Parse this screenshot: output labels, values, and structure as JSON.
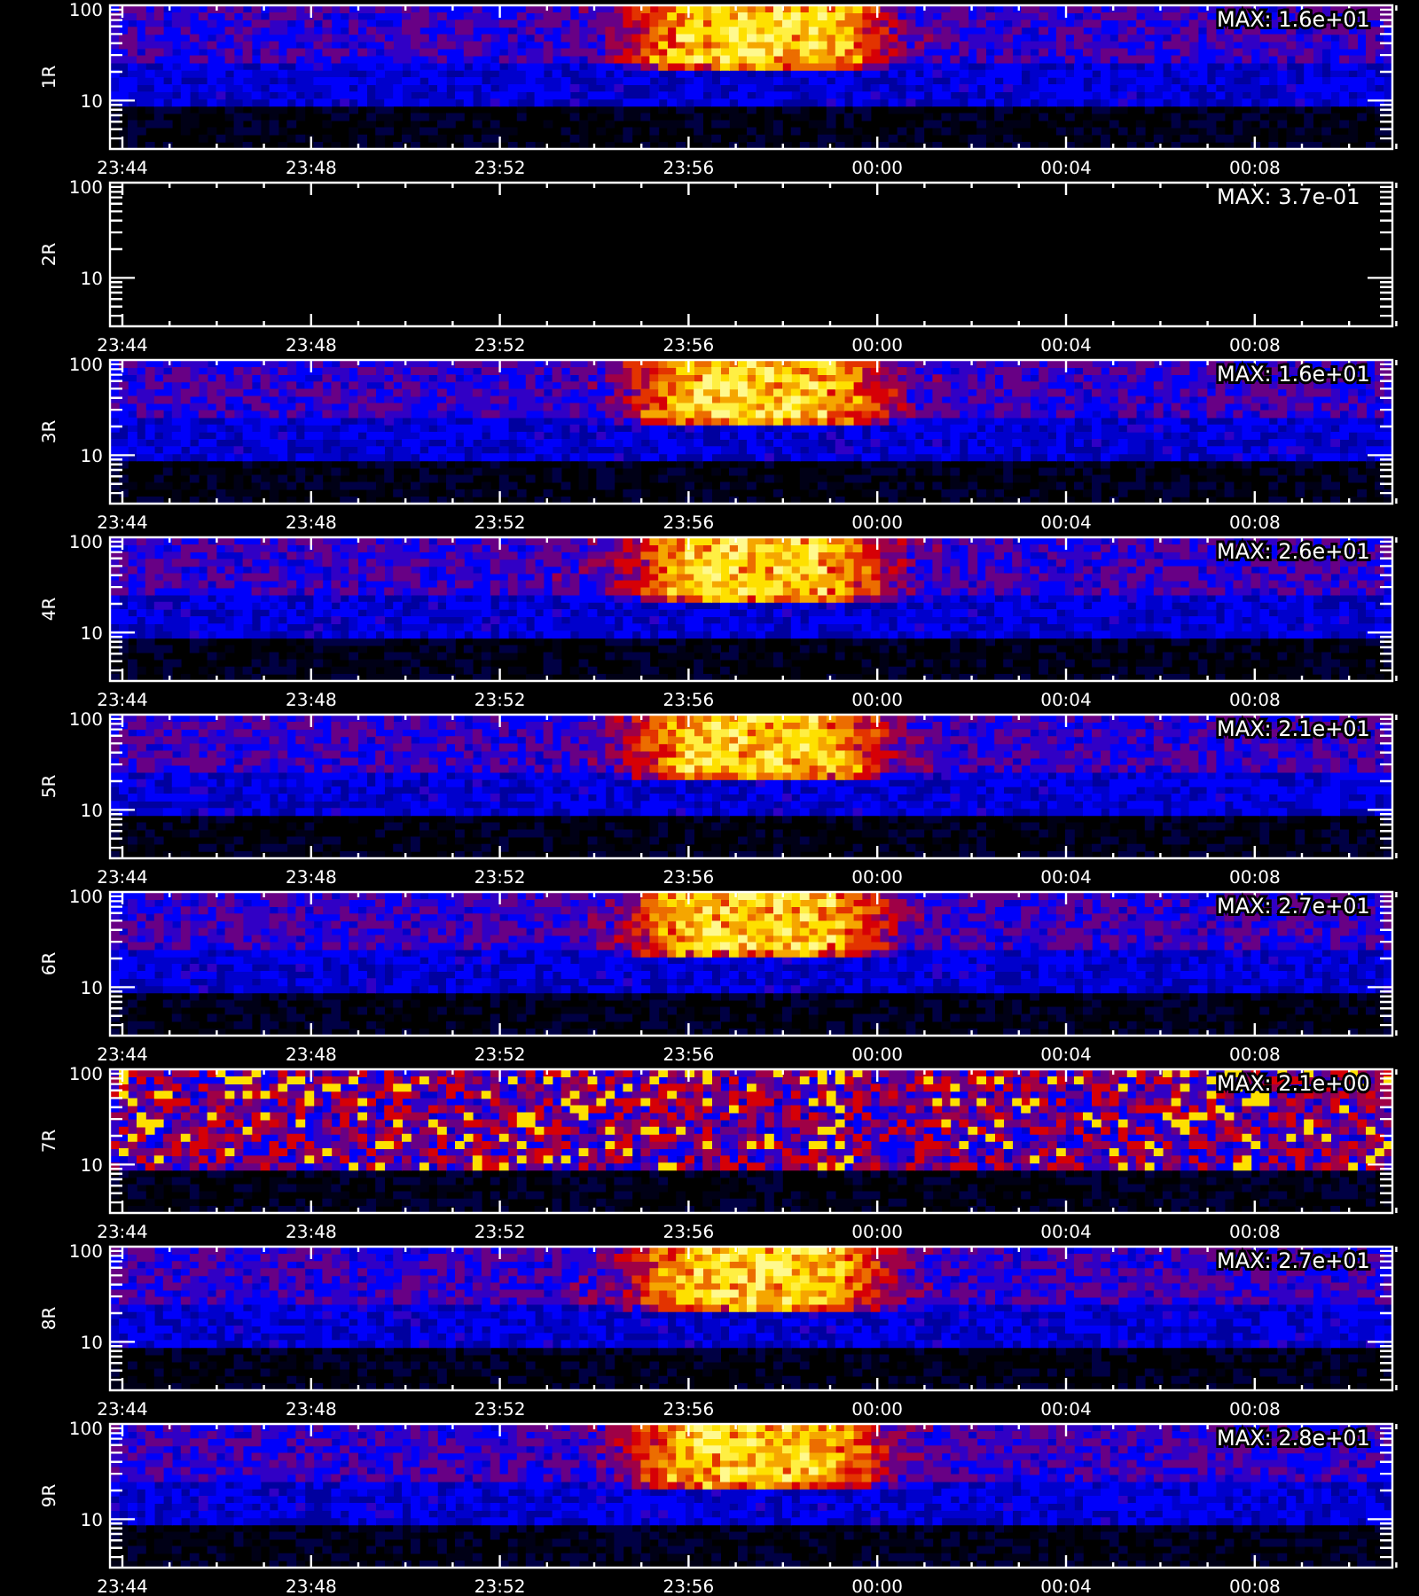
{
  "panels": [
    {
      "label": "1R",
      "max_label": "MAX: 1.6e+01",
      "kind": "spectrogram",
      "y_tick_labels": [
        "100",
        "10"
      ],
      "x_tick_labels": [
        "23:44",
        "23:48",
        "23:52",
        "23:56",
        "00:00",
        "00:04",
        "00:08"
      ]
    },
    {
      "label": "2R",
      "max_label": "MAX: 3.7e-01",
      "kind": "blank",
      "y_tick_labels": [
        "100",
        "10"
      ],
      "x_tick_labels": [
        "23:44",
        "23:48",
        "23:52",
        "23:56",
        "00:00",
        "00:04",
        "00:08"
      ]
    },
    {
      "label": "3R",
      "max_label": "MAX: 1.6e+01",
      "kind": "spectrogram",
      "y_tick_labels": [
        "100",
        "10"
      ],
      "x_tick_labels": [
        "23:44",
        "23:48",
        "23:52",
        "23:56",
        "00:00",
        "00:04",
        "00:08"
      ]
    },
    {
      "label": "4R",
      "max_label": "MAX: 2.6e+01",
      "kind": "spectrogram",
      "y_tick_labels": [
        "100",
        "10"
      ],
      "x_tick_labels": [
        "23:44",
        "23:48",
        "23:52",
        "23:56",
        "00:00",
        "00:04",
        "00:08"
      ]
    },
    {
      "label": "5R",
      "max_label": "MAX: 2.1e+01",
      "kind": "spectrogram",
      "y_tick_labels": [
        "100",
        "10"
      ],
      "x_tick_labels": [
        "23:44",
        "23:48",
        "23:52",
        "23:56",
        "00:00",
        "00:04",
        "00:08"
      ]
    },
    {
      "label": "6R",
      "max_label": "MAX: 2.7e+01",
      "kind": "spectrogram",
      "y_tick_labels": [
        "100",
        "10"
      ],
      "x_tick_labels": [
        "23:44",
        "23:48",
        "23:52",
        "23:56",
        "00:00",
        "00:04",
        "00:08"
      ]
    },
    {
      "label": "7R",
      "max_label": "MAX: 2.1e+00",
      "kind": "noisy",
      "y_tick_labels": [
        "100",
        "10"
      ],
      "x_tick_labels": [
        "23:44",
        "23:48",
        "23:52",
        "23:56",
        "00:00",
        "00:04",
        "00:08"
      ]
    },
    {
      "label": "8R",
      "max_label": "MAX: 2.7e+01",
      "kind": "spectrogram",
      "y_tick_labels": [
        "100",
        "10"
      ],
      "x_tick_labels": [
        "23:44",
        "23:48",
        "23:52",
        "23:56",
        "00:00",
        "00:04",
        "00:08"
      ]
    },
    {
      "label": "9R",
      "max_label": "MAX: 2.8e+01",
      "kind": "spectrogram",
      "y_tick_labels": [
        "100",
        "10"
      ],
      "x_tick_labels": [
        "23:44",
        "23:48",
        "23:52",
        "23:56",
        "00:00",
        "00:04",
        "00:08"
      ]
    }
  ]
}
